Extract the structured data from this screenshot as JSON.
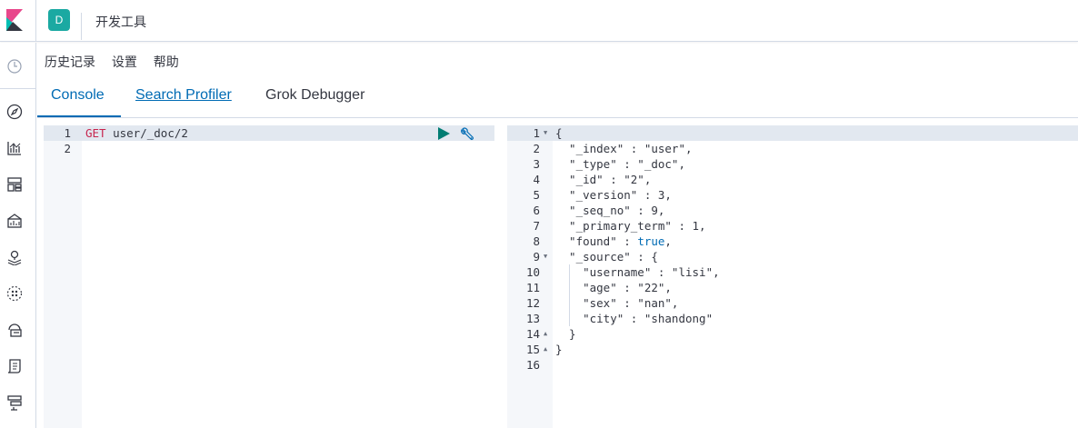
{
  "header": {
    "space_initial": "D",
    "breadcrumb": "开发工具"
  },
  "top_menu": {
    "history": "历史记录",
    "settings": "设置",
    "help": "帮助"
  },
  "tabs": {
    "console": "Console",
    "search_profiler": "Search Profiler",
    "grok_debugger": "Grok Debugger"
  },
  "request_editor": {
    "line_numbers": [
      "1",
      "2"
    ],
    "method": "GET",
    "path": "user/_doc/2"
  },
  "response_editor": {
    "line_numbers": [
      "1",
      "2",
      "3",
      "4",
      "5",
      "6",
      "7",
      "8",
      "9",
      "10",
      "11",
      "12",
      "13",
      "14",
      "15",
      "16"
    ],
    "lines": [
      "{",
      "  \"_index\" : \"user\",",
      "  \"_type\" : \"_doc\",",
      "  \"_id\" : \"2\",",
      "  \"_version\" : 3,",
      "  \"_seq_no\" : 9,",
      "  \"_primary_term\" : 1,",
      "  \"found\" : true,",
      "  \"_source\" : {",
      "    \"username\" : \"lisi\",",
      "    \"age\" : \"22\",",
      "    \"sex\" : \"nan\",",
      "    \"city\" : \"shandong\"",
      "  }",
      "}",
      ""
    ],
    "found_prefix": "  \"found\" : ",
    "found_value": "true",
    "found_suffix": ","
  },
  "icons": {
    "logo": "kibana-logo",
    "nav": [
      "clock-icon",
      "compass-icon",
      "visualize-icon",
      "dashboard-icon",
      "canvas-icon",
      "maps-icon",
      "ml-icon",
      "infrastructure-icon",
      "logs-icon",
      "apm-icon"
    ]
  },
  "colors": {
    "accent": "#006bb4",
    "space_avatar": "#1ba9a2",
    "method": "#c7254e",
    "run_button": "#017d73"
  }
}
